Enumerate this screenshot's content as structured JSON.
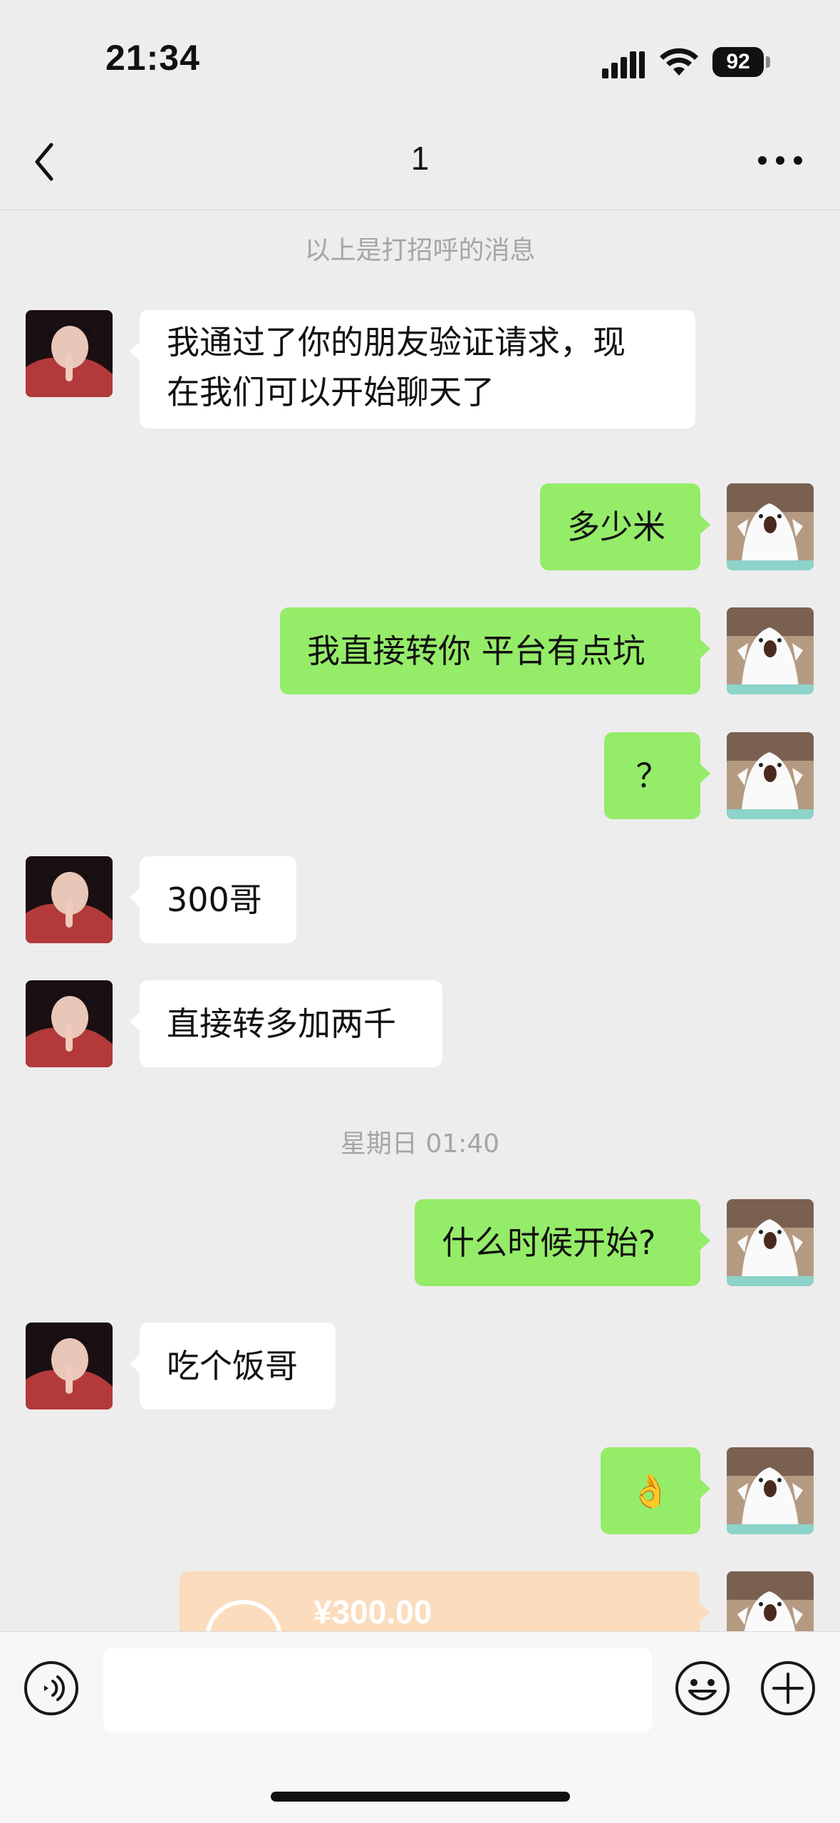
{
  "status_bar": {
    "time": "21:34",
    "battery": "92"
  },
  "nav": {
    "title": "1"
  },
  "system": {
    "greeting_note": "以上是打招呼的消息",
    "timestamp": "星期日 01:40"
  },
  "messages": [
    {
      "side": "received",
      "lines": [
        "我通过了你的朋友验证请求，现",
        "在我们可以开始聊天了"
      ]
    },
    {
      "side": "sent",
      "text": "多少米"
    },
    {
      "side": "sent",
      "text": "我直接转你 平台有点坑"
    },
    {
      "side": "sent",
      "text": "？"
    },
    {
      "side": "received",
      "text": "300哥"
    },
    {
      "side": "received",
      "text": "直接转多加两千"
    },
    {
      "side": "sent",
      "text": "什么时候开始?"
    },
    {
      "side": "received",
      "text": "吃个饭哥"
    },
    {
      "side": "sent",
      "text": "👌"
    }
  ],
  "transfer": {
    "amount": "¥300.00"
  },
  "input": {
    "placeholder": ""
  },
  "colors": {
    "sent_bubble": "#95ec69",
    "received_bubble": "#ffffff",
    "background": "#ededed",
    "transfer_card": "#fbdcbd"
  }
}
